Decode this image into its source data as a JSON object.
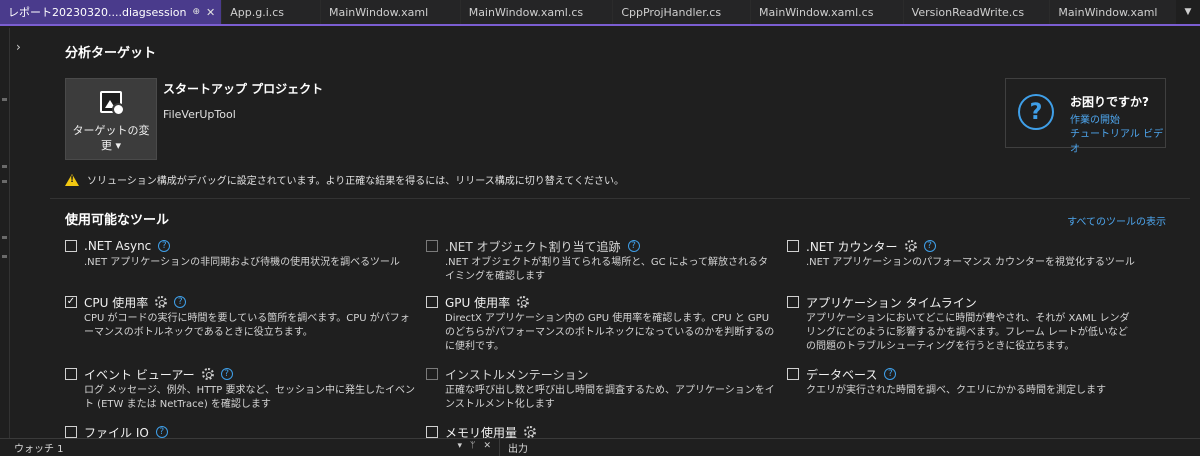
{
  "tabs": [
    {
      "label": "レポート20230320....diagsession",
      "active": true
    },
    {
      "label": "App.g.i.cs"
    },
    {
      "label": "MainWindow.xaml"
    },
    {
      "label": "MainWindow.xaml.cs"
    },
    {
      "label": "CppProjHandler.cs"
    },
    {
      "label": "MainWindow.xaml.cs"
    },
    {
      "label": "VersionReadWrite.cs"
    },
    {
      "label": "MainWindow.xaml"
    }
  ],
  "tab_pin": "⊕",
  "tab_close": "✕",
  "tab_overflow": "▼",
  "expander": "›",
  "target": {
    "section_title": "分析ターゲット",
    "change_button": "ターゲットの変更 ▾",
    "startup_title": "スタートアップ プロジェクト",
    "startup_project": "FileVerUpTool"
  },
  "help": {
    "title": "お困りですか?",
    "link_getting_started": "作業の開始",
    "link_tutorial": "チュートリアル ビデオ"
  },
  "warning": "ソリューション構成がデバッグに設定されています。より正確な結果を得るには、リリース構成に切り替えてください。",
  "tools_section": {
    "title": "使用可能なツール",
    "show_all": "すべてのツールの表示",
    "items": [
      {
        "name": ".NET Async",
        "desc": ".NET アプリケーションの非同期および待機の使用状況を調べるツール",
        "checked": false,
        "enabled": true,
        "gear": false,
        "help": true
      },
      {
        "name": ".NET オブジェクト割り当て追跡",
        "desc": ".NET オブジェクトが割り当てられる場所と、GC によって解放されるタイミングを確認します",
        "checked": false,
        "enabled": false,
        "gear": false,
        "help": true
      },
      {
        "name": ".NET カウンター",
        "desc": ".NET アプリケーションのパフォーマンス カウンターを視覚化するツール",
        "checked": false,
        "enabled": true,
        "gear": true,
        "help": true
      },
      {
        "name": "CPU 使用率",
        "desc": "CPU がコードの実行に時間を要している箇所を調べます。CPU がパフォーマンスのボトルネックであるときに役立ちます。",
        "checked": true,
        "enabled": true,
        "gear": true,
        "help": true
      },
      {
        "name": "GPU 使用率",
        "desc": "DirectX アプリケーション内の GPU 使用率を確認します。CPU と GPU のどちらがパフォーマンスのボトルネックになっているのかを判断するのに便利です。",
        "checked": false,
        "enabled": true,
        "gear": true,
        "help": false
      },
      {
        "name": "アプリケーション タイムライン",
        "desc": "アプリケーションにおいてどこに時間が費やされ、それが XAML レンダリングにどのように影響するかを調べます。フレーム レートが低いなどの問題のトラブルシューティングを行うときに役立ちます。",
        "checked": false,
        "enabled": true,
        "gear": false,
        "help": false
      },
      {
        "name": "イベント ビューアー",
        "desc": "ログ メッセージ、例外、HTTP 要求など、セッション中に発生したイベント (ETW または NetTrace) を確認します",
        "checked": false,
        "enabled": true,
        "gear": true,
        "help": true
      },
      {
        "name": "インストルメンテーション",
        "desc": "正確な呼び出し数と呼び出し時間を調査するため、アプリケーションをインストルメント化します",
        "checked": false,
        "enabled": false,
        "gear": false,
        "help": false
      },
      {
        "name": "データベース",
        "desc": "クエリが実行された時間を調べ、クエリにかかる時間を測定します",
        "checked": false,
        "enabled": true,
        "gear": false,
        "help": true
      },
      {
        "name": "ファイル IO",
        "desc": "",
        "checked": false,
        "enabled": true,
        "gear": false,
        "help": true
      },
      {
        "name": "メモリ使用量",
        "desc": "",
        "checked": false,
        "enabled": true,
        "gear": true,
        "help": false
      }
    ]
  },
  "bottom": {
    "watch_title": "ウォッチ 1",
    "watch_controls": [
      "▾",
      "ᛘ",
      "✕"
    ],
    "output_title": "出力"
  },
  "colors": {
    "accent": "#7b5ed1",
    "active_tab": "#4a3b8c",
    "link": "#4ea6ee",
    "warning": "#f2c811",
    "background": "#1f1f1f"
  }
}
